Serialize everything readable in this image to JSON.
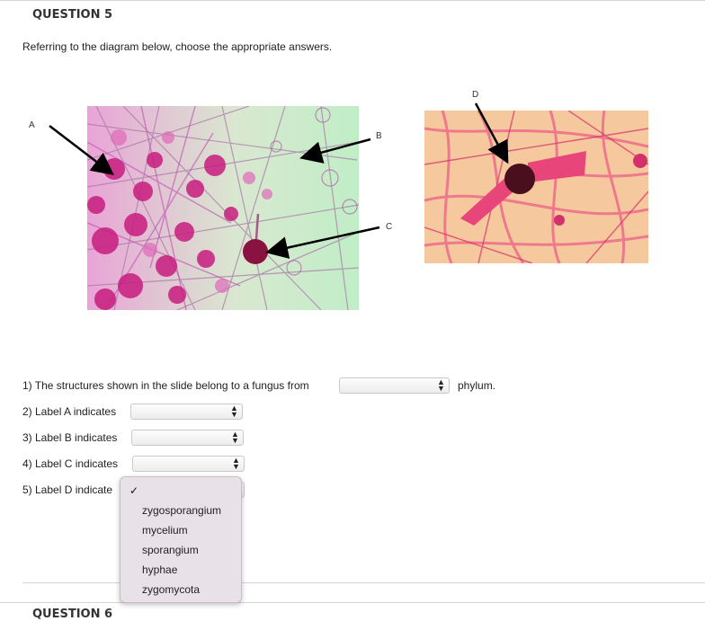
{
  "question": {
    "title": "QUESTION 5",
    "instructions": "Referring to the diagram below, choose the appropriate answers."
  },
  "diagram": {
    "labels": {
      "a": "A",
      "b": "B",
      "c": "C",
      "d": "D"
    }
  },
  "items": [
    {
      "prefix": "1) The structures shown in the slide belong to a fungus from",
      "suffix": "phylum.",
      "selected": ""
    },
    {
      "prefix": "2) Label A indicates",
      "selected": ""
    },
    {
      "prefix": "3) Label B indicates",
      "selected": ""
    },
    {
      "prefix": "4) Label C indicates",
      "selected": ""
    },
    {
      "prefix": "5) Label D indicate",
      "selected": ""
    }
  ],
  "dropdown": {
    "check": "✓",
    "options": [
      "zygosporangium",
      "mycelium",
      "sporangium",
      "hyphae",
      "zygomycota"
    ]
  },
  "next_question": {
    "title": "QUESTION 6"
  },
  "colors": {
    "slide_left_bg": "#c8ecc9",
    "slide_left_stain": "#d6249a",
    "slide_right_bg": "#f6c89e",
    "slide_right_stain": "#e23a6c",
    "menu_bg": "#e8e1e7"
  }
}
